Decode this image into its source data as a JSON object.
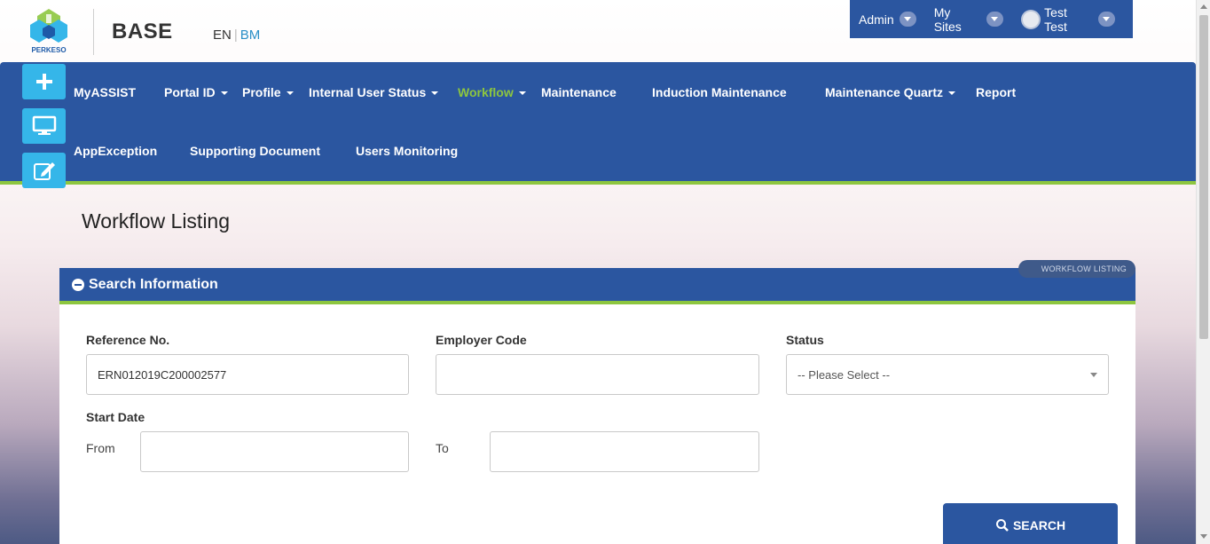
{
  "header": {
    "logo_text": "PERKESO",
    "brand": "BASE",
    "lang_en": "EN",
    "lang_bm": "BM",
    "user_menu": {
      "admin": "Admin",
      "my_sites": "My Sites",
      "user": "Test Test"
    }
  },
  "nav": {
    "items": [
      "MyASSIST",
      "Portal ID",
      "Profile",
      "Internal User Status",
      "Workflow",
      "Maintenance",
      "Induction Maintenance",
      "Maintenance Quartz",
      "Report",
      "AppException",
      "Supporting Document",
      "Users Monitoring"
    ],
    "active": "Workflow",
    "active_color": "#8dc63f",
    "bar_color": "#2b56a0"
  },
  "side_buttons": [
    "plus-icon",
    "monitor-icon",
    "edit-icon"
  ],
  "page": {
    "title": "Workflow Listing",
    "breadcrumb": "WORKFLOW LISTING"
  },
  "search_panel": {
    "title": "Search Information",
    "reference_label": "Reference No.",
    "reference_value": "ERN012019C200002577",
    "employer_label": "Employer Code",
    "employer_value": "",
    "status_label": "Status",
    "status_selected": "-- Please Select --",
    "start_date_label": "Start Date",
    "from_label": "From",
    "to_label": "To",
    "from_value": "",
    "to_value": "",
    "search_button": "SEARCH"
  }
}
